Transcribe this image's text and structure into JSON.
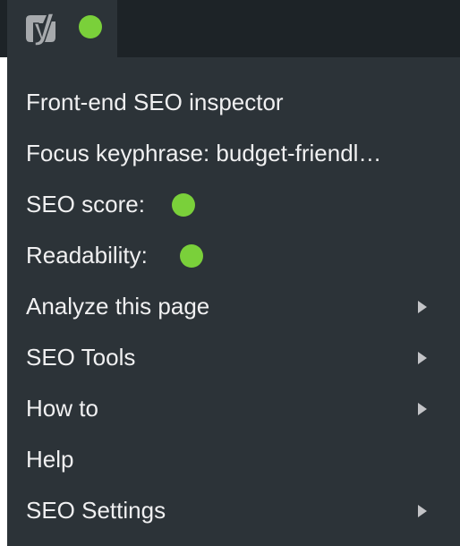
{
  "colors": {
    "adminbar_bg": "#1d2327",
    "menu_bg": "#2c3338",
    "text": "#f0f0f1",
    "status_good": "#7ad03a",
    "arrow": "#c3c4c7"
  },
  "adminbar": {
    "logo_icon": "yoast-logo-icon",
    "status": "good"
  },
  "menu": {
    "items": [
      {
        "label": "Front-end SEO inspector"
      },
      {
        "label": "Focus keyphrase: budget-friendl…"
      },
      {
        "label": "SEO score:",
        "status": "good"
      },
      {
        "label": "Readability:",
        "status": "good"
      },
      {
        "label": "Analyze this page",
        "submenu": true
      },
      {
        "label": "SEO Tools",
        "submenu": true
      },
      {
        "label": "How to",
        "submenu": true
      },
      {
        "label": "Help"
      },
      {
        "label": "SEO Settings",
        "submenu": true
      }
    ]
  }
}
